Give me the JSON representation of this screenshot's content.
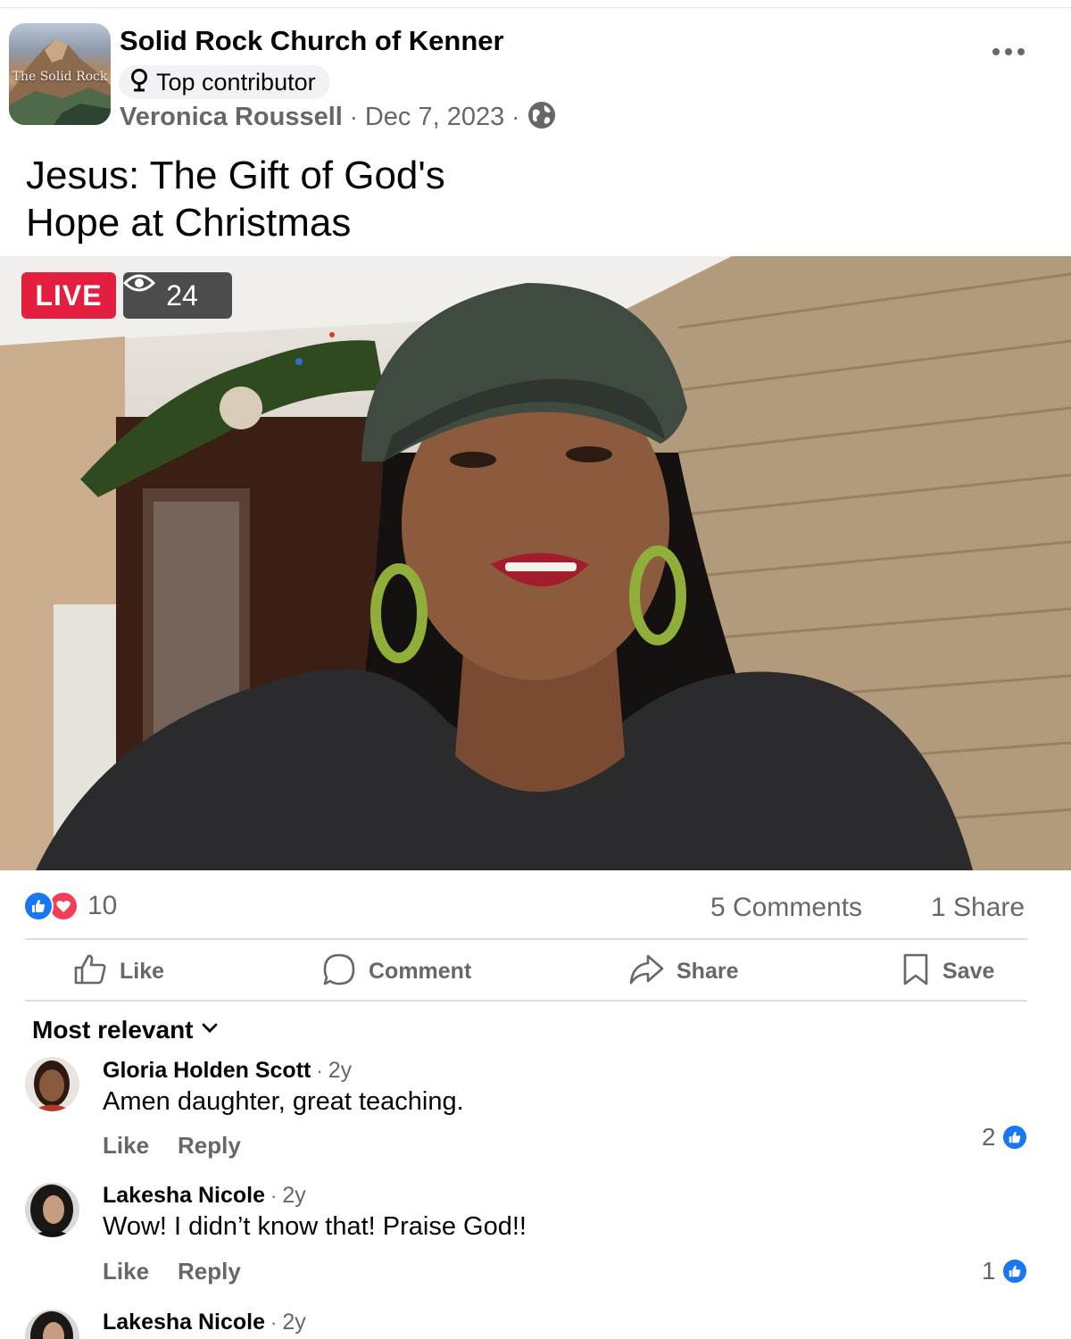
{
  "post": {
    "page_name": "Solid Rock Church of Kenner",
    "avatar_text": "The Solid Rock",
    "badge": "Top contributor",
    "author": "Veronica Roussell",
    "separator": "·",
    "date": "Dec 7, 2023",
    "privacy_icon": "globe-icon",
    "title_line1": "Jesus: The Gift of God's",
    "title_line2": "Hope at Christmas"
  },
  "video": {
    "live_label": "LIVE",
    "viewers": "24",
    "viewer_icon": "eye-icon"
  },
  "stats": {
    "reaction_count": "10",
    "reaction_icons": [
      "like-icon",
      "love-icon"
    ],
    "comments": "5 Comments",
    "shares": "1 Share"
  },
  "actions": {
    "like": "Like",
    "comment": "Comment",
    "share": "Share",
    "save": "Save"
  },
  "comments_section": {
    "sort_label": "Most relevant",
    "like_label": "Like",
    "reply_label": "Reply",
    "items": [
      {
        "name": "Gloria Holden Scott",
        "time": "2y",
        "text": "Amen daughter, great teaching.",
        "likes": "2"
      },
      {
        "name": "Lakesha Nicole",
        "time": "2y",
        "text": "Wow! I didn’t know that! Praise God!!",
        "likes": "1"
      },
      {
        "name": "Lakesha Nicole",
        "time": "2y"
      }
    ]
  },
  "colors": {
    "accent": "#1877f2",
    "live": "#e41e3f",
    "love": "#f33e58",
    "secondary_text": "#65676b"
  }
}
